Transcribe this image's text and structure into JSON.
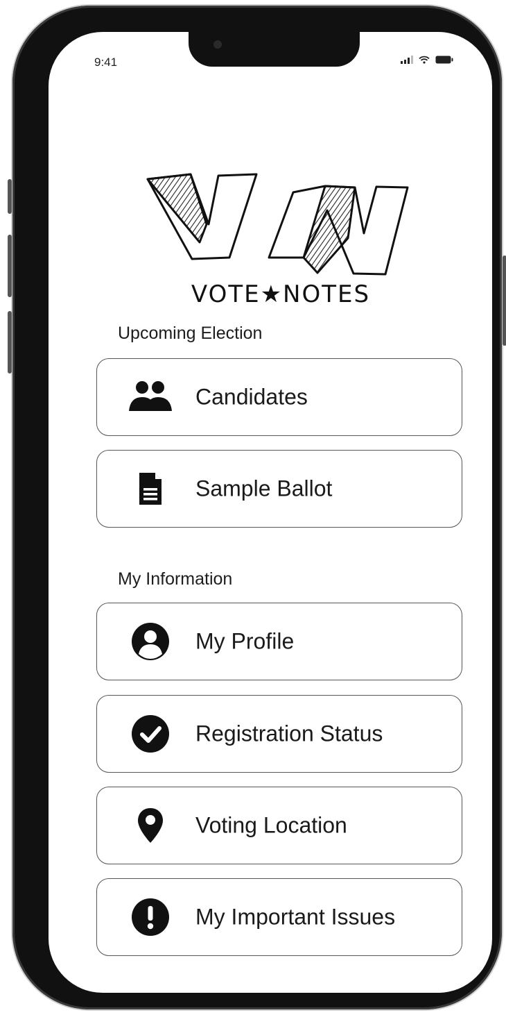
{
  "status_bar": {
    "time": "9:41"
  },
  "logo": {
    "initials": "VN",
    "wordmark": "VOTE★NOTES"
  },
  "sections": {
    "upcoming_election": {
      "title": "Upcoming Election",
      "items": [
        {
          "label": "Candidates",
          "icon": "users-icon"
        },
        {
          "label": "Sample Ballot",
          "icon": "document-icon"
        }
      ]
    },
    "my_information": {
      "title": "My Information",
      "items": [
        {
          "label": "My Profile",
          "icon": "user-circle-icon"
        },
        {
          "label": "Registration Status",
          "icon": "check-circle-icon"
        },
        {
          "label": "Voting Location",
          "icon": "map-pin-icon"
        },
        {
          "label": "My Important Issues",
          "icon": "exclamation-circle-icon"
        }
      ]
    }
  },
  "colors": {
    "frame": "#111111",
    "ink": "#1a1a1a",
    "button_border": "#555555",
    "background": "#ffffff"
  }
}
